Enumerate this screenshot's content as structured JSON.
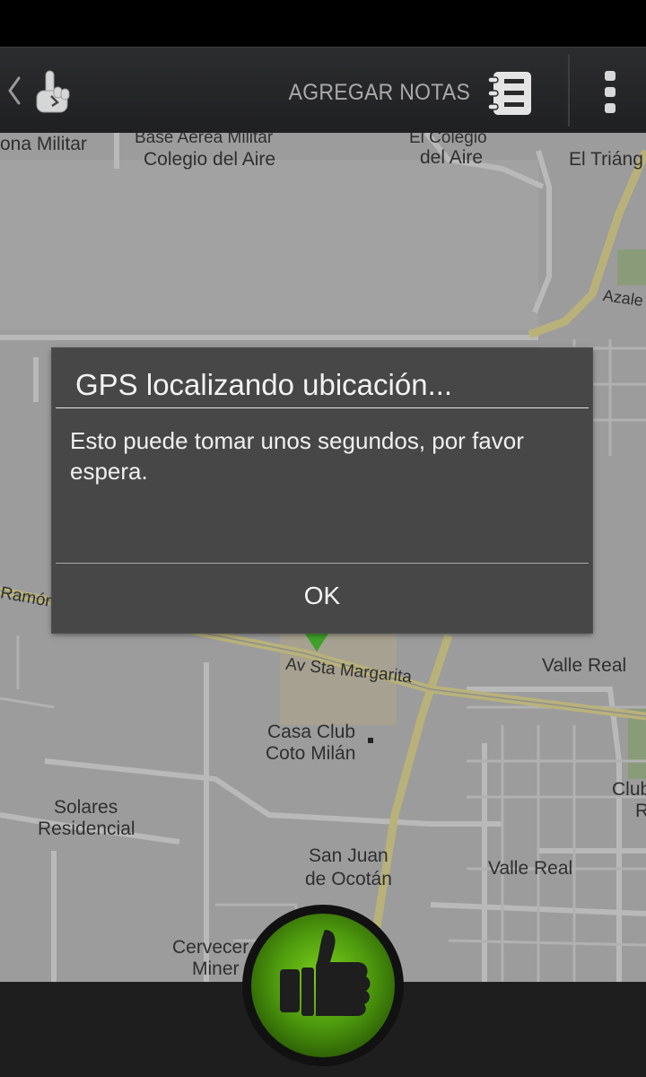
{
  "action_bar": {
    "add_notes_label": "AGREGAR NOTAS"
  },
  "map": {
    "labels": {
      "zona_militar": "ona Militar",
      "base_aerea": "Base Aérea Militar",
      "colegio_del_aire": "Colegio del Aire",
      "el_colegio": "El Colegio",
      "del_aire": "del Aire",
      "el_triangulo": "El Triáng",
      "azalea": "Azale",
      "ramon": "Ramór",
      "av_sta_margarita": "Av Sta Margarita",
      "valle_real_1": "Valle Real",
      "casa_club": "Casa Club",
      "coto_milan": "Coto Milán",
      "club": "Club",
      "club_r": "R",
      "solares": "Solares",
      "residencial": "Residencial",
      "san_juan": "San Juan",
      "de_ocotan": "de Ocotán",
      "valle_real_2": "Valle Real",
      "cervecer": "Cervecer",
      "miner": "Miner"
    }
  },
  "dialog": {
    "title": "GPS localizando ubicación...",
    "message": "Esto puede tomar unos segundos, por favor espera.",
    "ok_label": "OK"
  },
  "colors": {
    "map_background": "#9c9c9c",
    "road_yellow": "#b5b07a",
    "dialog_background": "#474747",
    "thumb_green": "#5fb012"
  }
}
